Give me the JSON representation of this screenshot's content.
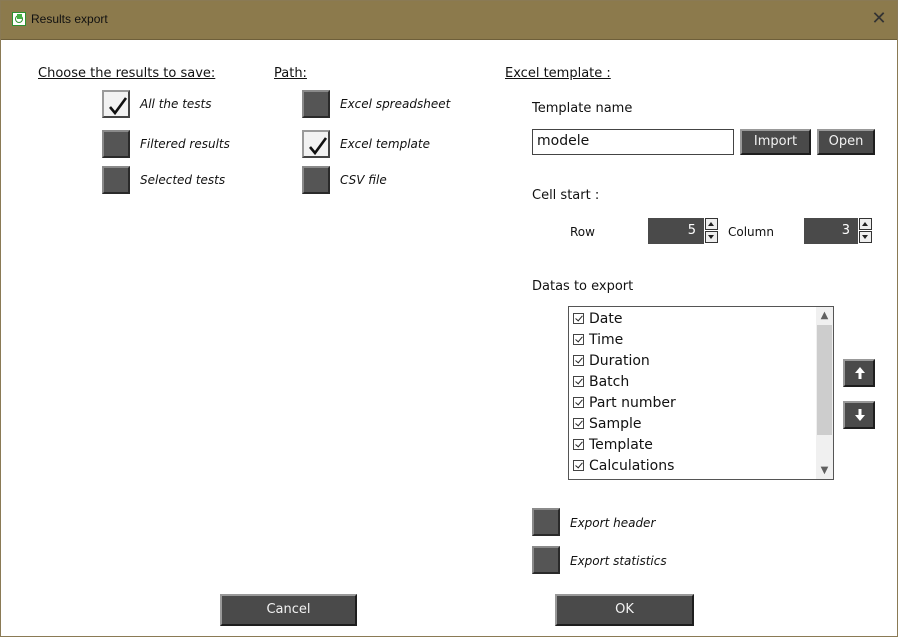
{
  "window": {
    "title": "Results export",
    "close_glyph": "✕",
    "icon": "app-icon"
  },
  "results_section": {
    "heading": "Choose the results to save:",
    "options": [
      {
        "label": "All the tests",
        "checked": true
      },
      {
        "label": "Filtered results",
        "checked": false
      },
      {
        "label": "Selected tests",
        "checked": false
      }
    ]
  },
  "path_section": {
    "heading": "Path:",
    "options": [
      {
        "label": "Excel spreadsheet",
        "checked": false
      },
      {
        "label": "Excel template",
        "checked": true
      },
      {
        "label": "CSV file",
        "checked": false
      }
    ]
  },
  "excel_template": {
    "heading": "Excel template :",
    "template_name_label": "Template name",
    "template_name_value": "modele",
    "import_label": "Import",
    "open_label": "Open",
    "cell_start_label": "Cell start :",
    "row_label": "Row",
    "row_value": "5",
    "column_label": "Column",
    "column_value": "3",
    "datas_label": "Datas to export",
    "datas_items": [
      "Date",
      "Time",
      "Duration",
      "Batch",
      "Part number",
      "Sample",
      "Template",
      "Calculations"
    ],
    "export_header_label": "Export header",
    "export_statistics_label": "Export statistics",
    "export_header_checked": false,
    "export_statistics_checked": false
  },
  "footer": {
    "cancel_label": "Cancel",
    "ok_label": "OK"
  },
  "colors": {
    "titlebar": "#8c7a4c",
    "button": "#4a4a4a",
    "checkbox_off": "#555555"
  }
}
